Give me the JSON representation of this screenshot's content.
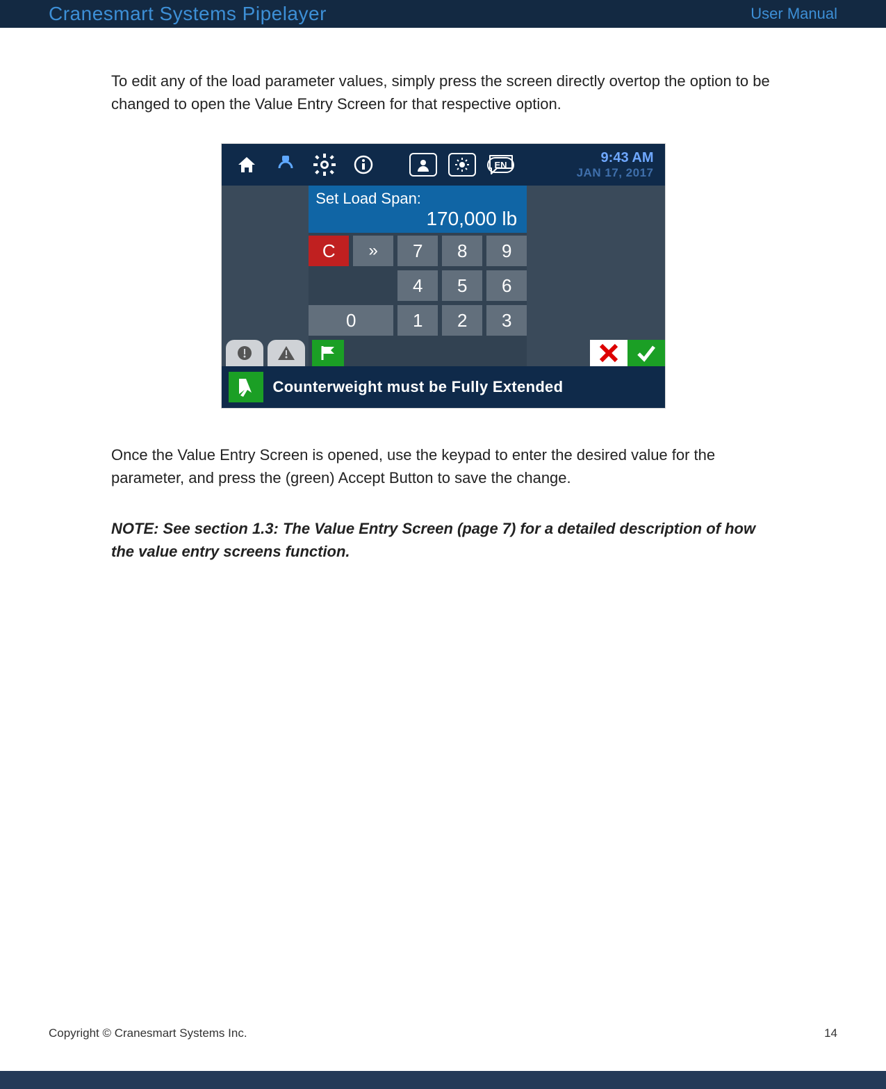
{
  "header": {
    "title": "Cranesmart Systems Pipelayer",
    "subtitle": "User Manual"
  },
  "body": {
    "para1": "To edit any of the load parameter values, simply press the screen directly overtop the option to be changed to open the Value Entry Screen for that respective option.",
    "para2": "Once the Value Entry Screen is opened, use the keypad to enter the desired value for the parameter, and press the (green) Accept Button to save the change.",
    "note": "NOTE: See section 1.3: The Value Entry Screen (page 7) for a detailed description of how the value entry screens function."
  },
  "device": {
    "clock": {
      "time": "9:43 AM",
      "date": "JAN 17, 2017"
    },
    "lang": "EN",
    "prompt": {
      "label": "Set Load Span:",
      "value": "170,000 lb"
    },
    "keys": {
      "c": "C",
      "shift": "»",
      "k7": "7",
      "k8": "8",
      "k9": "9",
      "k4": "4",
      "k5": "5",
      "k6": "6",
      "k0": "0",
      "k1": "1",
      "k2": "2",
      "k3": "3"
    },
    "status": "Counterweight must be Fully Extended"
  },
  "footer": {
    "copyright": "Copyright © Cranesmart Systems Inc.",
    "page": "14"
  }
}
